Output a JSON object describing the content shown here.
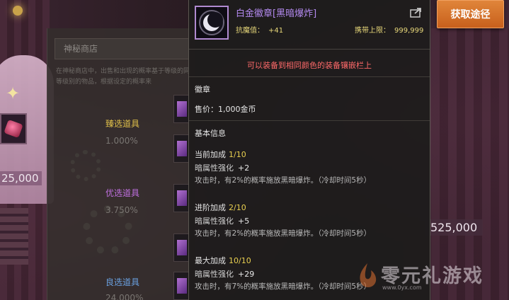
{
  "item": {
    "name": "白金徽章[黑暗爆炸]",
    "resist_label": "抗魔值：",
    "resist_value": "+41",
    "carry_label": "携带上限：",
    "carry_value": "999,999",
    "notice": "可以装备到相同颜色的装备镶嵌栏上",
    "type": "徽章",
    "price_label": "售价：",
    "price_value": "1,000金币",
    "section_title": "基本信息",
    "tiers": [
      {
        "label": "当前加成",
        "value": "1/10",
        "stat_label": "暗属性强化",
        "stat_value": "+2",
        "effect": "攻击时，有2%的概率施放黑暗爆炸。（冷却时间5秒）"
      },
      {
        "label": "进阶加成",
        "value": "2/10",
        "stat_label": "暗属性强化",
        "stat_value": "+5",
        "effect": "攻击时，有2%的概率施放黑暗爆炸。（冷却时间5秒）"
      },
      {
        "label": "最大加成",
        "value": "10/10",
        "stat_label": "暗属性强化",
        "stat_value": "+29",
        "effect": "攻击时，有7%的概率施放黑暗爆炸。（冷却时间5秒）"
      }
    ]
  },
  "get_source_button": "获取途径",
  "shop": {
    "title": "神秘商店",
    "description": "在神秘商店中，出售和出现的概率基于等级的同等级别的物品，根据设定的概率来",
    "rows": [
      {
        "label": "臻选道具",
        "pct": "1.000%",
        "color": "#e0c04a"
      },
      {
        "label": "优选道具",
        "pct": "3.750%",
        "color": "#c070e0"
      },
      {
        "label": "良选道具",
        "pct": "24.000%",
        "color": "#6aa0e0"
      }
    ]
  },
  "scene": {
    "price_left": "25,000",
    "price_right": "525,000"
  },
  "watermark": {
    "text": "零元礼游戏",
    "url": "www.0yx.com"
  },
  "colors": {
    "item_name": "#b48af0",
    "accent_yellow": "#e8cf50",
    "notice_red": "#ff6a6a",
    "button_orange": "#d8702a"
  },
  "icons": [
    "crescent-moon-badge-icon",
    "share-icon",
    "sparkle-icon",
    "gear-icon"
  ]
}
